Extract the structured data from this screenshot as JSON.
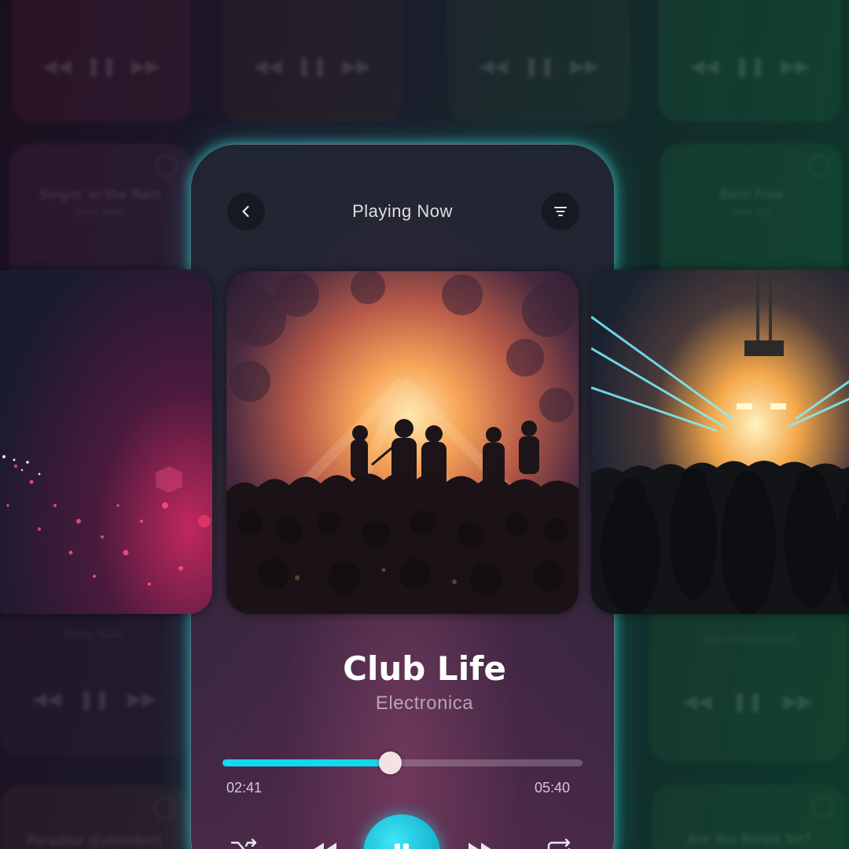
{
  "background": {
    "cards": [
      {
        "title": "",
        "subtitle": ""
      },
      {
        "title": "Singin' in the Rain",
        "subtitle": "Gene Kelly"
      },
      {
        "title": "",
        "subtitle": "Jimmy Taylor"
      },
      {
        "title": "Paradise (Extended)",
        "subtitle": ""
      },
      {
        "title": "Born Free",
        "subtitle": "Mike Tyo"
      },
      {
        "title": "",
        "subtitle": "Logic Entertainment"
      },
      {
        "title": "Are You Bored Yet?",
        "subtitle": ""
      }
    ]
  },
  "player": {
    "header_title": "Playing Now",
    "song_title": "Club Life",
    "genre": "Electronica",
    "elapsed": "02:41",
    "duration": "05:40",
    "progress_fraction": 0.465
  },
  "colors": {
    "accent": "#14d8ec",
    "glow": "#3ce6dc",
    "thumb": "#f4e2e2"
  },
  "icons": {
    "back": "chevron-left-icon",
    "menu": "filter-icon",
    "shuffle": "shuffle-icon",
    "previous": "rewind-icon",
    "play_pause": "pause-icon",
    "next": "fast-forward-icon",
    "repeat": "repeat-icon"
  }
}
